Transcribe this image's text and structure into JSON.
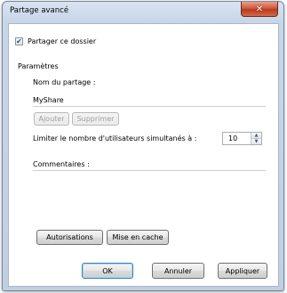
{
  "window": {
    "title": "Partage avancé",
    "close_glyph": "✕"
  },
  "share": {
    "checkbox_label": "Partager ce dossier",
    "checked": true,
    "check_glyph": "✔"
  },
  "settings": {
    "group_label": "Paramètres",
    "share_name_label": "Nom du partage :",
    "share_name_value": "MyShare",
    "add_label": "Ajouter",
    "remove_label": "Supprimer",
    "limit_label": "Limiter le nombre d'utilisateurs simultanés à :",
    "limit_value": "10",
    "spin_up": "▲",
    "spin_down": "▼",
    "comments_label": "Commentaires :"
  },
  "actions": {
    "permissions_label": "Autorisations",
    "caching_label": "Mise en cache"
  },
  "footer": {
    "ok_label": "OK",
    "cancel_label": "Annuler",
    "apply_label": "Appliquer"
  }
}
